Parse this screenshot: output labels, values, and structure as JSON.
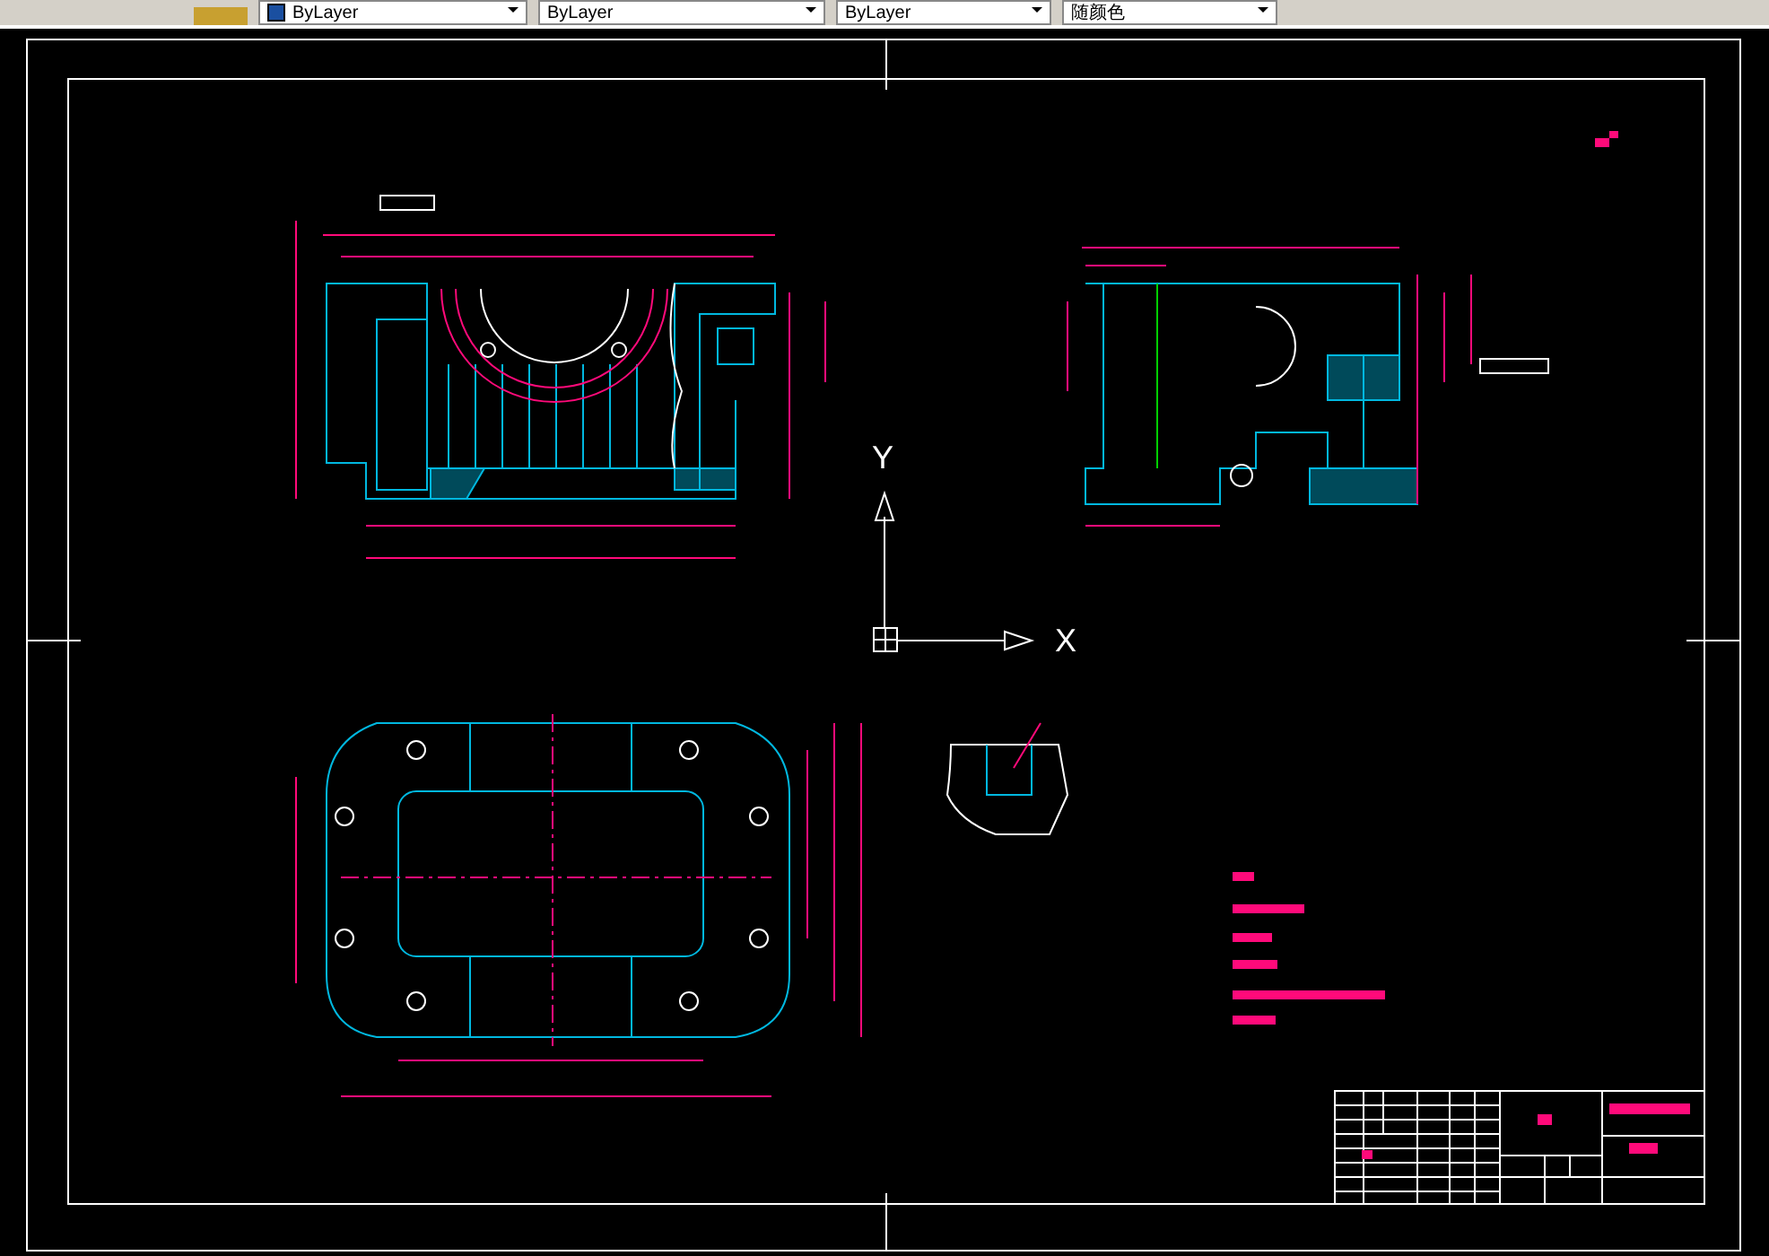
{
  "toolbar": {
    "dropdowns": [
      {
        "value": "ByLayer",
        "kind": "linetype"
      },
      {
        "value": "ByLayer",
        "kind": "plain"
      },
      {
        "value": "ByLayer",
        "kind": "plain"
      },
      {
        "value": "随颜色",
        "kind": "plain"
      }
    ]
  },
  "canvas": {
    "ucs": {
      "x_label": "X",
      "y_label": "Y"
    }
  }
}
